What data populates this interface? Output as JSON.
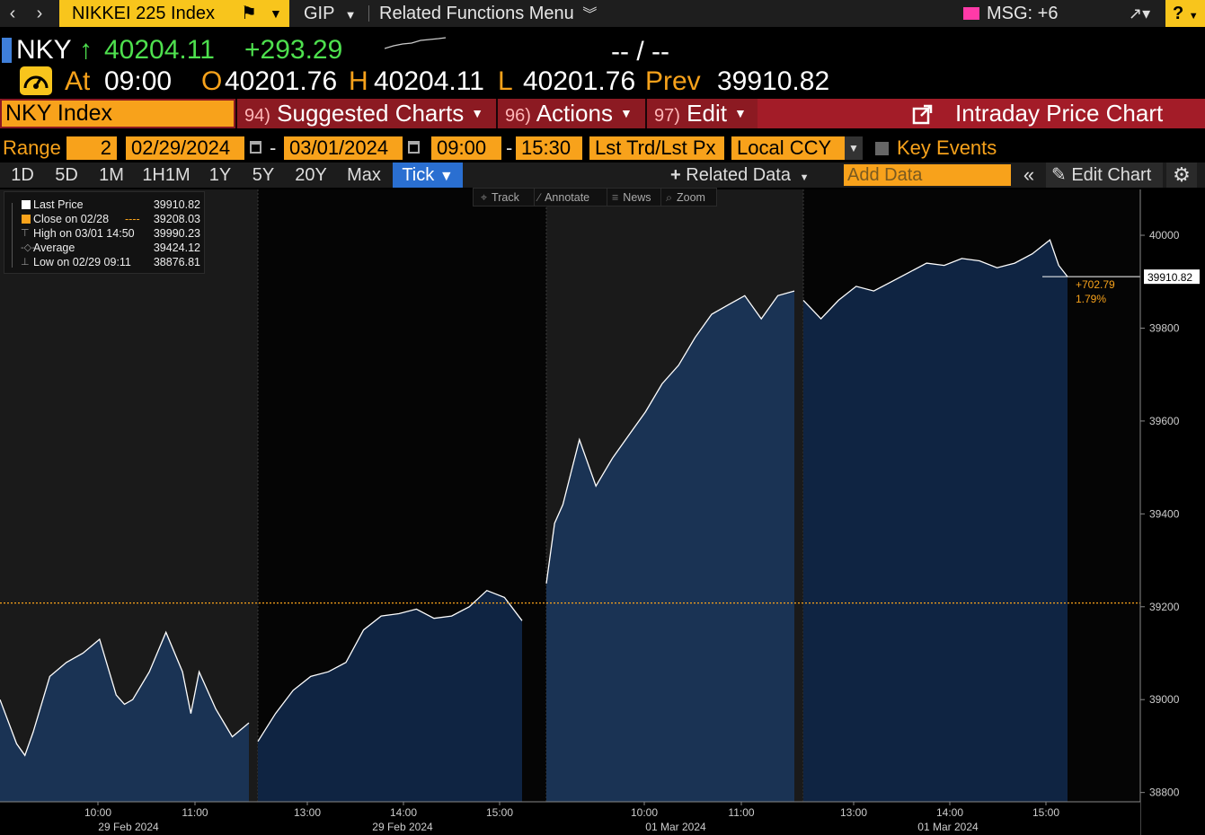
{
  "topbar": {
    "security": "NIKKEI 225 Index",
    "gip": "GIP",
    "related_functions": "Related Functions Menu",
    "msg": "MSG: +6",
    "help": "?"
  },
  "quote": {
    "ticker": "NKY",
    "last": "40204.11",
    "change": "+293.29",
    "bid_ask": "-- / --",
    "at_label": "At",
    "at_time": "09:00",
    "open_label": "O",
    "open": "40201.76",
    "high_label": "H",
    "high": "40204.11",
    "low_label": "L",
    "low": "40201.76",
    "prev_label": "Prev",
    "prev": "39910.82"
  },
  "funcbar": {
    "ticker_input": "NKY Index",
    "suggested_num": "94)",
    "suggested": "Suggested Charts",
    "actions_num": "96)",
    "actions": "Actions",
    "edit_num": "97)",
    "edit": "Edit",
    "title": "Intraday Price Chart"
  },
  "rangebar": {
    "range_label": "Range",
    "range_days": "2",
    "start_date": "02/29/2024",
    "end_date": "03/01/2024",
    "start_time": "09:00",
    "end_time": "15:30",
    "price_type": "Lst Trd/Lst Px",
    "currency": "Local CCY",
    "key_events": "Key Events"
  },
  "periodbar": {
    "periods": [
      "1D",
      "5D",
      "1M",
      "1H1M",
      "1Y",
      "5Y",
      "20Y",
      "Max"
    ],
    "tick": "Tick",
    "related_data": "Related Data",
    "add_data_placeholder": "Add Data",
    "edit_chart": "Edit Chart"
  },
  "legend": [
    {
      "name": "Last Price",
      "value": "39910.82",
      "color": "#ffffff"
    },
    {
      "name": "Close on 02/28",
      "value": "39208.03",
      "color": "#f8a21b"
    },
    {
      "name": "High on 03/01 14:50",
      "value": "39990.23",
      "color": ""
    },
    {
      "name": "Average",
      "value": "39424.12",
      "color": ""
    },
    {
      "name": "Low on 02/29 09:11",
      "value": "38876.81",
      "color": ""
    }
  ],
  "tools": {
    "track": "Track",
    "annotate": "Annotate",
    "news": "News",
    "zoom": "Zoom"
  },
  "colors": {
    "accent_orange": "#f8a21b",
    "accent_yellow": "#f8c51c",
    "positive": "#4ee04e",
    "func_bar": "#8c1a22",
    "area_fill": "#1a3354"
  },
  "chart_data": {
    "type": "area",
    "xlabel": "",
    "ylabel": "",
    "ylim": [
      38780,
      40060
    ],
    "yticks": [
      38800,
      39000,
      39200,
      39400,
      39600,
      39800,
      40000
    ],
    "prev_close": 39208.03,
    "last_price": 39910.82,
    "last_price_label": "39910.82",
    "change_label": "+702.79",
    "change_pct_label": "1.79%",
    "x_ticks": [
      {
        "label": "10:00",
        "date": "29 Feb 2024"
      },
      {
        "label": "11:00",
        "date": ""
      },
      {
        "label": "13:00",
        "date": ""
      },
      {
        "label": "14:00",
        "date": "29 Feb 2024"
      },
      {
        "label": "15:00",
        "date": ""
      },
      {
        "label": "10:00",
        "date": "01 Mar 2024"
      },
      {
        "label": "11:00",
        "date": ""
      },
      {
        "label": "13:00",
        "date": ""
      },
      {
        "label": "14:00",
        "date": "01 Mar 2024"
      },
      {
        "label": "15:00",
        "date": ""
      }
    ],
    "series": [
      {
        "name": "Last Price",
        "segments": [
          {
            "session": "29 Feb 2024 AM",
            "x": [
              "09:00",
              "09:10",
              "09:15",
              "09:20",
              "09:30",
              "09:40",
              "09:50",
              "10:00",
              "10:10",
              "10:15",
              "10:20",
              "10:30",
              "10:40",
              "10:50",
              "10:55",
              "11:00",
              "11:10",
              "11:20",
              "11:30"
            ],
            "y": [
              39000,
              38905,
              38880,
              38930,
              39050,
              39080,
              39100,
              39130,
              39010,
              38990,
              39000,
              39060,
              39145,
              39060,
              38970,
              39060,
              38980,
              38920,
              38950
            ]
          },
          {
            "session": "29 Feb 2024 PM",
            "x": [
              "12:30",
              "12:40",
              "12:50",
              "13:00",
              "13:10",
              "13:20",
              "13:30",
              "13:40",
              "13:50",
              "14:00",
              "14:10",
              "14:20",
              "14:30",
              "14:40",
              "14:50",
              "15:00"
            ],
            "y": [
              38910,
              38970,
              39020,
              39050,
              39060,
              39080,
              39150,
              39180,
              39185,
              39195,
              39175,
              39180,
              39200,
              39235,
              39220,
              39170
            ]
          },
          {
            "session": "01 Mar 2024 AM",
            "x": [
              "09:00",
              "09:05",
              "09:10",
              "09:20",
              "09:30",
              "09:40",
              "09:50",
              "10:00",
              "10:10",
              "10:20",
              "10:30",
              "10:40",
              "10:50",
              "11:00",
              "11:10",
              "11:20",
              "11:30"
            ],
            "y": [
              39250,
              39380,
              39420,
              39560,
              39460,
              39520,
              39570,
              39620,
              39680,
              39720,
              39780,
              39830,
              39850,
              39870,
              39820,
              39870,
              39880
            ]
          },
          {
            "session": "01 Mar 2024 PM",
            "x": [
              "12:30",
              "12:40",
              "12:50",
              "13:00",
              "13:10",
              "13:20",
              "13:30",
              "13:40",
              "13:50",
              "14:00",
              "14:10",
              "14:20",
              "14:30",
              "14:40",
              "14:50",
              "14:55",
              "15:00"
            ],
            "y": [
              39860,
              39820,
              39860,
              39890,
              39880,
              39900,
              39920,
              39940,
              39935,
              39950,
              39945,
              39930,
              39940,
              39960,
              39990,
              39935,
              39911
            ]
          }
        ]
      }
    ]
  }
}
